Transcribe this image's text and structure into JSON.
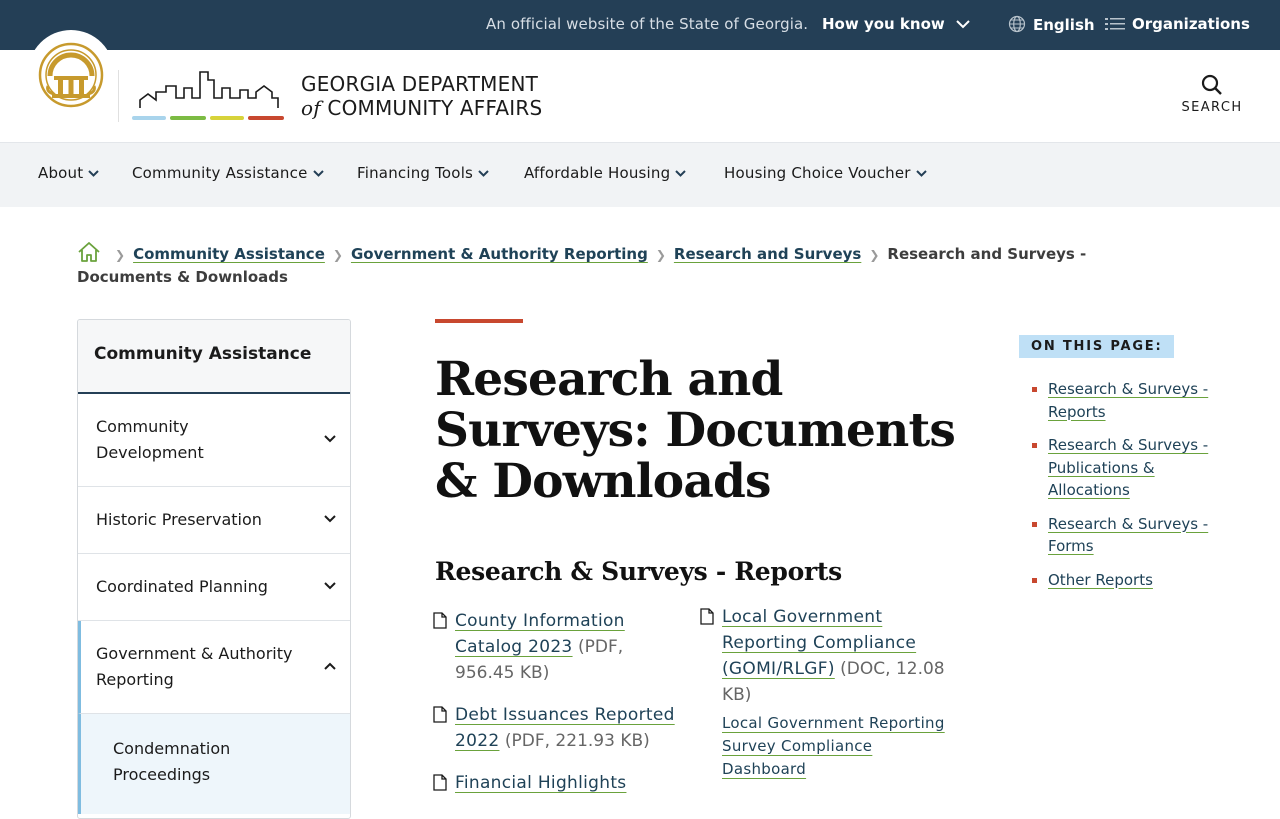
{
  "topbar": {
    "official_text": "An official website of the State of Georgia.",
    "how_you_know": "How you know",
    "language": "English",
    "organizations": "Organizations"
  },
  "header": {
    "dept_line1": "GEORGIA DEPARTMENT",
    "dept_of": "of",
    "dept_line2": "COMMUNITY AFFAIRS",
    "search_label": "SEARCH"
  },
  "nav": {
    "items": [
      "About",
      "Community Assistance",
      "Financing Tools",
      "Affordable Housing",
      "Housing Choice Voucher"
    ]
  },
  "breadcrumb": {
    "links": [
      "Community Assistance",
      "Government & Authority Reporting",
      "Research and Surveys"
    ],
    "current": "Research and Surveys - Documents & Downloads"
  },
  "sidebar": {
    "title": "Community Assistance",
    "items": [
      "Community Development",
      "Historic Preservation",
      "Coordinated Planning",
      "Government & Authority Reporting"
    ],
    "sub_item": "Condemnation Proceedings"
  },
  "main": {
    "title": "Research and Surveys: Documents & Downloads",
    "section_title": "Research & Surveys - Reports",
    "docs": [
      {
        "title": "County Information Catalog 2023",
        "meta": "(PDF, 956.45 KB)"
      },
      {
        "title": "Debt Issuances Reported 2022",
        "meta": "(PDF, 221.93 KB)"
      },
      {
        "title": "Financial Highlights",
        "meta": ""
      },
      {
        "title": "Local Government Reporting Compliance (GOMI/RLGF)",
        "meta": "(DOC, 12.08 KB)",
        "extra": "Local Government Reporting Survey Compliance Dashboard"
      }
    ]
  },
  "on_this_page": {
    "title": "ON THIS PAGE:",
    "links": [
      "Research & Surveys - Reports",
      "Research & Surveys - Publications & Allocations",
      "Research & Surveys - Forms",
      "Other Reports"
    ]
  },
  "colors": {
    "topbar_bg": "#243f56",
    "accent_red": "#c8482f",
    "link_underline": "#6aa23c",
    "nav_bg": "#f1f3f5",
    "otp_badge": "#bfe0f6"
  }
}
